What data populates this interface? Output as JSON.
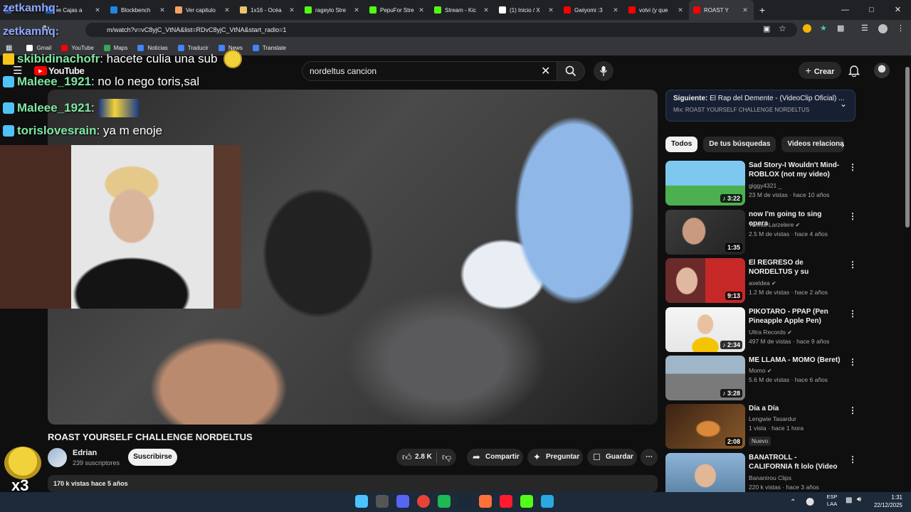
{
  "browser": {
    "tabs": [
      {
        "label": "",
        "color": "#3a5aa8"
      },
      {
        "label": "re Cajas a",
        "color": "#2a6bd1"
      },
      {
        "label": "Blockbench",
        "color": "#1e88e5"
      },
      {
        "label": "Ver capitulo",
        "color": "#f4a261"
      },
      {
        "label": "1x16 - Océa",
        "color": "#e9c46a"
      },
      {
        "label": "rageylo Stre",
        "color": "#53fc18"
      },
      {
        "label": "PepuFor Stre",
        "color": "#53fc18"
      },
      {
        "label": "Stream - Kic",
        "color": "#53fc18"
      },
      {
        "label": "(1) Inicio / X",
        "color": "#ffffff"
      },
      {
        "label": "Gwiyomi :3",
        "color": "#ff0000"
      },
      {
        "label": "volvi (y que",
        "color": "#ff0000"
      },
      {
        "label": "ROAST Y",
        "color": "#ff0000"
      }
    ],
    "new_tab": "+",
    "url": "m/watch?v=vC8yjC_VtNA&list=RDvC8yjC_VtNA&start_radio=1",
    "bookmarks": [
      "Gmail",
      "YouTube",
      "Maps",
      "Noticias",
      "Traducir",
      "News",
      "Translate"
    ]
  },
  "overlay": {
    "top_user": "zetkamhq:",
    "chat": [
      {
        "user": "skibidinachofr",
        "msg": ": hacete culia una sub",
        "badge_color": "#f5c518"
      },
      {
        "user": "Maleee_1921",
        "msg": ": no lo nego toris,sal",
        "badge_color": "#4fc3f7"
      },
      {
        "user": "Maleee_1921",
        "msg": ":",
        "badge_color": "#4fc3f7"
      },
      {
        "user": "torislovesrain",
        "msg": ": ya m enoje",
        "badge_color": "#4fc3f7"
      }
    ],
    "emote_count": "x3"
  },
  "youtube": {
    "logo": "YouTube",
    "search_value": "nordeltus cancion",
    "create_label": "Crear",
    "video": {
      "title": "ROAST YOURSELF CHALLENGE NORDELTUS",
      "channel": "Edrian",
      "subscribers": "239 suscriptores",
      "subscribe_label": "Suscribirse",
      "likes": "2.8 K",
      "share_label": "Compartir",
      "ask_label": "Preguntar",
      "save_label": "Guardar",
      "meta": "170 k vistas  hace 5 años"
    },
    "up_next": {
      "prefix": "Siguiente:",
      "title": "El Rap del Demente - (VideoClip Oficial) ...",
      "mix": "Mix: ROAST YOURSELF CHALLENGE NORDELTUS"
    },
    "chips": [
      "Todos",
      "De tus búsquedas",
      "Videos relacionado"
    ],
    "recommendations": [
      {
        "title": "Sad Story-I Wouldn't Mind- ROBLOX (not my video)",
        "channel": "giggy4321 _",
        "meta": "23 M de vistas · hace 10 años",
        "duration": "♪ 3:22",
        "verified": false,
        "thumb": "linear-gradient(180deg,#7ec8f0 0 55%,#4caf50 56% 100%)"
      },
      {
        "title": "now I'm going to sing opera",
        "channel": "Teresa Larzelere",
        "meta": "2.5 M de vistas · hace 4 años",
        "duration": "1:35",
        "verified": true,
        "thumb": "radial-gradient(ellipse 26px 30px at 40px 30px,#c99a80 0 60%,transparent 65%),linear-gradient(135deg,#3c3c3c,#222)"
      },
      {
        "title": "El REGRESO de NORDELTUS y su CONFESIÓN sobre ELO ...",
        "channel": "axeldea",
        "meta": "1.2 M de vistas · hace 2 años",
        "duration": "9:13",
        "verified": true,
        "thumb": "radial-gradient(ellipse 24px 30px at 30px 32px,#e0b8a0 0 60%,transparent 65%),linear-gradient(90deg,#6b2a2a 0 50%,#c62828 50% 100%)"
      },
      {
        "title": "PIKOTARO - PPAP (Pen Pineapple Apple Pen) (Long ...",
        "channel": "Ultra Records",
        "meta": "497 M de vistas · hace 9 años",
        "duration": "♪ 2:34",
        "verified": true,
        "thumb": "radial-gradient(ellipse 18px 22px at 56px 24px,#e8c2a0 0 60%,transparent 65%),radial-gradient(ellipse 30px 22px at 56px 56px,#f5c400 0 60%,transparent 65%),linear-gradient(#f5f5f5,#e6e6e6)"
      },
      {
        "title": "ME LLAMA - MOMO (Beret)",
        "channel": "Momo",
        "meta": "5.6 M de vistas · hace 6 años",
        "duration": "♪ 3:28",
        "verified": true,
        "thumb": "linear-gradient(180deg,#9fb6c8 0 40%,#7a7a7a 41% 100%)"
      },
      {
        "title": "Día a Día",
        "channel": "Lengwie Tasardur",
        "meta": "1 vista · hace 1 hora",
        "duration": "2:08",
        "verified": false,
        "new": "Nuevo",
        "thumb": "radial-gradient(ellipse 30px 20px at 60px 35px,#d88a3a 0 50%,transparent 60%),linear-gradient(135deg,#3a2214,#8a5a2a)"
      },
      {
        "title": "BANATROLL - CALIFORNIA ft lolo (Video Oficial)",
        "channel": "Bananirou Clips",
        "meta": "220 k vistas · hace 3 años",
        "duration": "",
        "verified": false,
        "thumb": "radial-gradient(ellipse 24px 26px at 56px 32px,#e2b796 0 60%,transparent 65%),linear-gradient(180deg,#8db4d8,#5a7fa0)"
      }
    ]
  },
  "taskbar": {
    "apps": [
      {
        "name": "windows-start-icon",
        "color": "#4cc2ff"
      },
      {
        "name": "app-icon",
        "color": "#555555"
      },
      {
        "name": "discord-icon",
        "color": "#5865f2"
      },
      {
        "name": "chrome-icon",
        "color": "#ea4335"
      },
      {
        "name": "spotify-icon",
        "color": "#1db954"
      },
      {
        "name": "steam-icon",
        "color": "#1b2838"
      },
      {
        "name": "firefox-icon",
        "color": "#ff7139"
      },
      {
        "name": "opera-icon",
        "color": "#ff1b2d"
      },
      {
        "name": "kick-icon",
        "color": "#53fc18"
      },
      {
        "name": "files-icon",
        "color": "#2aa8e0"
      }
    ],
    "lang": "ESP",
    "lang2": "LAA",
    "time": "1:31",
    "date": "22/12/2025"
  }
}
